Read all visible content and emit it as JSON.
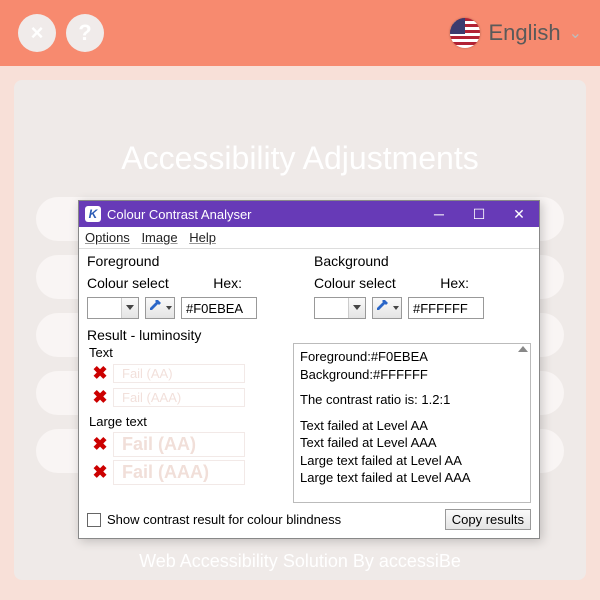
{
  "header": {
    "close_icon": "×",
    "help_icon": "?",
    "language_label": "English"
  },
  "panel": {
    "title": "Accessibility Adjustments",
    "footer": "Web Accessibility Solution By accessiBe"
  },
  "cca": {
    "title": "Colour Contrast Analyser",
    "menu": {
      "options": "Options",
      "image": "Image",
      "help": "Help"
    },
    "foreground": {
      "group": "Foreground",
      "select_label": "Colour select",
      "hex_label": "Hex:",
      "hex_value": "#F0EBEA"
    },
    "background": {
      "group": "Background",
      "select_label": "Colour select",
      "hex_label": "Hex:",
      "hex_value": "#FFFFFF"
    },
    "result_title": "Result - luminosity",
    "text_label": "Text",
    "large_text_label": "Large text",
    "fail_aa": "Fail (AA)",
    "fail_aaa": "Fail (AAA)",
    "pane": {
      "l1": "Foreground:#F0EBEA",
      "l2": "Background:#FFFFFF",
      "l3": "The contrast ratio is: 1.2:1",
      "l4": "Text failed at Level AA",
      "l5": "Text failed at Level AAA",
      "l6": "Large text failed at Level AA",
      "l7": "Large text failed at Level AAA"
    },
    "colour_blind_label": "Show contrast result for colour blindness",
    "copy_label": "Copy results"
  }
}
